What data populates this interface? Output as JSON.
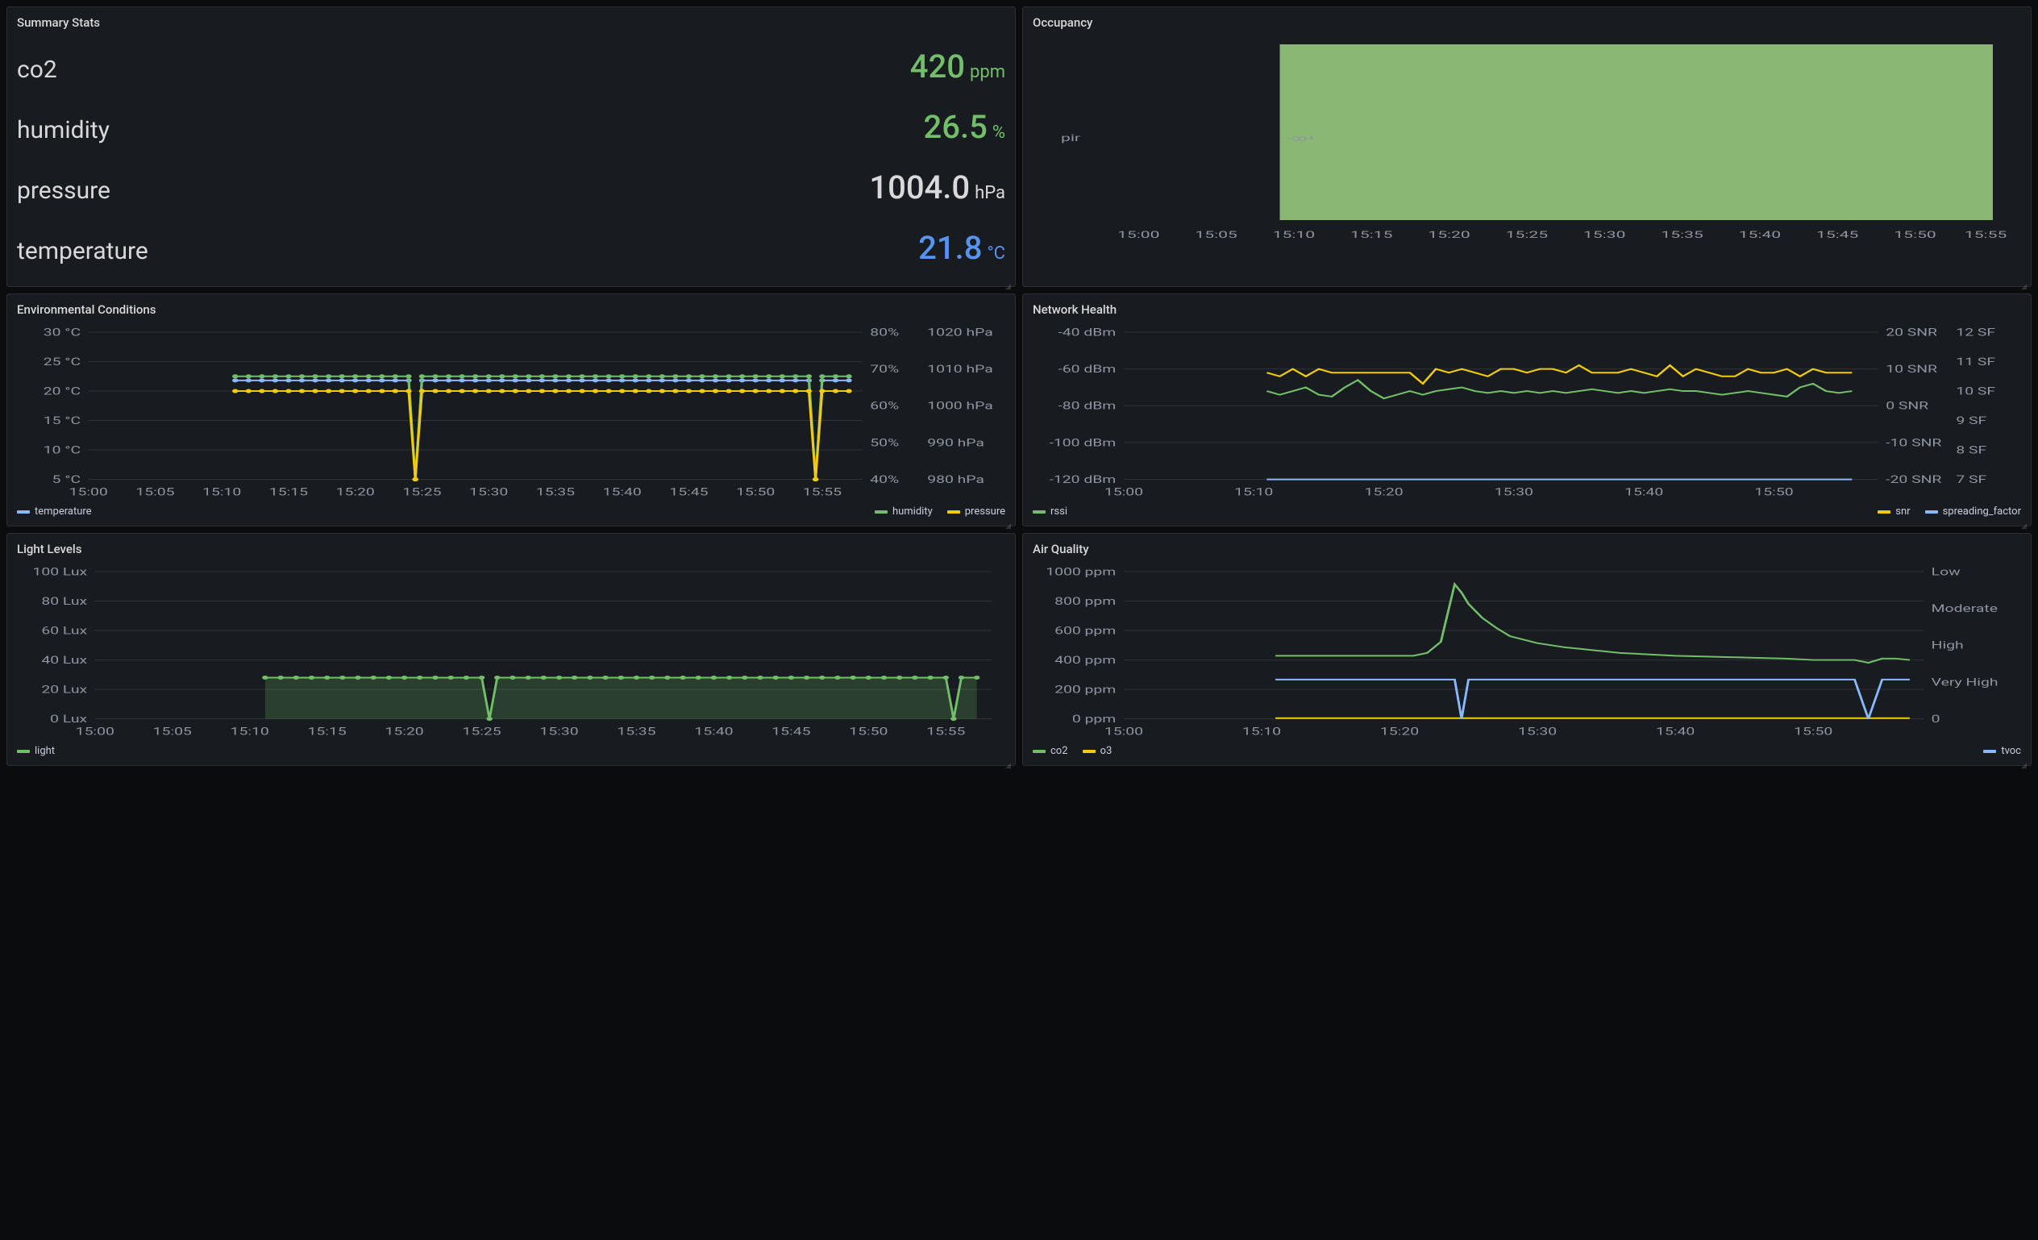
{
  "panels": {
    "summary": {
      "title": "Summary Stats",
      "stats": {
        "co2": {
          "label": "co2",
          "value": "420",
          "unit": "ppm",
          "color": "green"
        },
        "humidity": {
          "label": "humidity",
          "value": "26.5",
          "unit": "%",
          "color": "green"
        },
        "pressure": {
          "label": "pressure",
          "value": "1004.0",
          "unit": "hPa",
          "color": "white"
        },
        "temperature": {
          "label": "temperature",
          "value": "21.8",
          "unit": "°C",
          "color": "blue"
        }
      }
    },
    "occupancy": {
      "title": "Occupancy",
      "ylabel": "pir",
      "annotation": "-∞+"
    },
    "env": {
      "title": "Environmental Conditions"
    },
    "network": {
      "title": "Network Health"
    },
    "light": {
      "title": "Light Levels"
    },
    "air": {
      "title": "Air Quality"
    }
  },
  "legends": {
    "env": {
      "temperature": "temperature",
      "humidity": "humidity",
      "pressure": "pressure"
    },
    "network": {
      "rssi": "rssi",
      "snr": "snr",
      "sf": "spreading_factor"
    },
    "light": {
      "light": "light"
    },
    "air": {
      "co2": "co2",
      "o3": "o3",
      "tvoc": "tvoc"
    }
  },
  "colors": {
    "green": "#73bf69",
    "yellow": "#f2cc0c",
    "blue": "#8ab8ff",
    "lightblue": "#8ab8ff",
    "white": "#d8d9da"
  },
  "chart_data": [
    {
      "id": "occupancy",
      "type": "heatmap",
      "title": "Occupancy",
      "xlabel": "",
      "ylabel": "pir",
      "x_ticks": [
        "15:00",
        "15:05",
        "15:10",
        "15:15",
        "15:20",
        "15:25",
        "15:30",
        "15:35",
        "15:40",
        "15:45",
        "15:50",
        "15:55"
      ],
      "filled_from": "15:10",
      "filled_to": "15:57",
      "annotation": "-∞+"
    },
    {
      "id": "environmental_conditions",
      "type": "line",
      "title": "Environmental Conditions",
      "x": [
        "15:11",
        "15:12",
        "15:13",
        "15:14",
        "15:15",
        "15:16",
        "15:17",
        "15:18",
        "15:19",
        "15:20",
        "15:21",
        "15:22",
        "15:23",
        "15:24",
        "15:24:30",
        "15:25",
        "15:26",
        "15:27",
        "15:28",
        "15:29",
        "15:30",
        "15:31",
        "15:32",
        "15:33",
        "15:34",
        "15:35",
        "15:36",
        "15:37",
        "15:38",
        "15:39",
        "15:40",
        "15:41",
        "15:42",
        "15:43",
        "15:44",
        "15:45",
        "15:46",
        "15:47",
        "15:48",
        "15:49",
        "15:50",
        "15:51",
        "15:52",
        "15:53",
        "15:54",
        "15:54:30",
        "15:55",
        "15:56",
        "15:57"
      ],
      "series": [
        {
          "name": "temperature",
          "unit": "°C",
          "axis": "left",
          "color": "#8ab8ff",
          "values": [
            21.8,
            21.8,
            21.8,
            21.8,
            21.8,
            21.8,
            21.8,
            21.8,
            21.8,
            21.8,
            21.8,
            21.8,
            21.8,
            21.8,
            5,
            21.8,
            21.8,
            21.8,
            21.8,
            21.8,
            21.8,
            21.8,
            21.8,
            21.8,
            21.8,
            21.8,
            21.8,
            21.8,
            21.8,
            21.8,
            21.8,
            21.8,
            21.8,
            21.8,
            21.8,
            21.8,
            21.8,
            21.8,
            21.8,
            21.8,
            21.8,
            21.8,
            21.8,
            21.8,
            21.8,
            5,
            21.8,
            21.8,
            21.8
          ]
        },
        {
          "name": "humidity",
          "unit": "%",
          "axis": "right1",
          "color": "#73bf69",
          "values": [
            68,
            68,
            68,
            68,
            68,
            68,
            68,
            68,
            68,
            68,
            68,
            68,
            68,
            68,
            40,
            68,
            68,
            68,
            68,
            68,
            68,
            68,
            68,
            68,
            68,
            68,
            68,
            68,
            68,
            68,
            68,
            68,
            68,
            68,
            68,
            68,
            68,
            68,
            68,
            68,
            68,
            68,
            68,
            68,
            68,
            40,
            68,
            68,
            68
          ]
        },
        {
          "name": "pressure",
          "unit": "hPa",
          "axis": "right2",
          "color": "#f2cc0c",
          "values": [
            1004,
            1004,
            1004,
            1004,
            1004,
            1004,
            1004,
            1004,
            1004,
            1004,
            1004,
            1004,
            1004,
            1004,
            980,
            1004,
            1004,
            1004,
            1004,
            1004,
            1004,
            1004,
            1004,
            1004,
            1004,
            1004,
            1004,
            1004,
            1004,
            1004,
            1004,
            1004,
            1004,
            1004,
            1004,
            1004,
            1004,
            1004,
            1004,
            1004,
            1004,
            1004,
            1004,
            1004,
            1004,
            980,
            1004,
            1004,
            1004
          ]
        }
      ],
      "axes": {
        "left": {
          "label": "",
          "ticks": [
            "5 °C",
            "10 °C",
            "15 °C",
            "20 °C",
            "25 °C",
            "30 °C"
          ],
          "range": [
            5,
            30
          ]
        },
        "right1": {
          "label": "",
          "ticks": [
            "40%",
            "50%",
            "60%",
            "70%",
            "80%"
          ],
          "range": [
            40,
            80
          ]
        },
        "right2": {
          "label": "",
          "ticks": [
            "980 hPa",
            "990 hPa",
            "1000 hPa",
            "1010 hPa",
            "1020 hPa"
          ],
          "range": [
            980,
            1020
          ]
        }
      },
      "x_ticks": [
        "15:00",
        "15:05",
        "15:10",
        "15:15",
        "15:20",
        "15:25",
        "15:30",
        "15:35",
        "15:40",
        "15:45",
        "15:50",
        "15:55"
      ]
    },
    {
      "id": "network_health",
      "type": "line",
      "title": "Network Health",
      "x": [
        "15:11",
        "15:12",
        "15:13",
        "15:14",
        "15:15",
        "15:16",
        "15:17",
        "15:18",
        "15:19",
        "15:20",
        "15:21",
        "15:22",
        "15:23",
        "15:24",
        "15:25",
        "15:26",
        "15:27",
        "15:28",
        "15:29",
        "15:30",
        "15:31",
        "15:32",
        "15:33",
        "15:34",
        "15:35",
        "15:36",
        "15:37",
        "15:38",
        "15:39",
        "15:40",
        "15:41",
        "15:42",
        "15:43",
        "15:44",
        "15:45",
        "15:46",
        "15:47",
        "15:48",
        "15:49",
        "15:50",
        "15:51",
        "15:52",
        "15:53",
        "15:54",
        "15:55",
        "15:56"
      ],
      "series": [
        {
          "name": "rssi",
          "unit": "dBm",
          "axis": "left",
          "color": "#73bf69",
          "values": [
            -72,
            -74,
            -72,
            -70,
            -74,
            -75,
            -70,
            -66,
            -72,
            -76,
            -74,
            -72,
            -74,
            -72,
            -71,
            -70,
            -72,
            -73,
            -72,
            -73,
            -72,
            -73,
            -72,
            -73,
            -72,
            -71,
            -72,
            -73,
            -72,
            -73,
            -72,
            -71,
            -72,
            -72,
            -73,
            -74,
            -73,
            -72,
            -73,
            -74,
            -75,
            -70,
            -68,
            -72,
            -73,
            -72
          ]
        },
        {
          "name": "snr",
          "unit": "SNR",
          "axis": "right1",
          "color": "#f2cc0c",
          "values": [
            9,
            8,
            10,
            8,
            10,
            9,
            9,
            9,
            9,
            9,
            9,
            9,
            6,
            10,
            9,
            10,
            9,
            8,
            10,
            10,
            9,
            10,
            10,
            9,
            11,
            9,
            9,
            9,
            10,
            9,
            8,
            11,
            8,
            10,
            9,
            8,
            8,
            10,
            9,
            9,
            10,
            8,
            10,
            9,
            9,
            9
          ]
        },
        {
          "name": "spreading_factor",
          "unit": "SF",
          "axis": "right2",
          "color": "#8ab8ff",
          "values": [
            7,
            7,
            7,
            7,
            7,
            7,
            7,
            7,
            7,
            7,
            7,
            7,
            7,
            7,
            7,
            7,
            7,
            7,
            7,
            7,
            7,
            7,
            7,
            7,
            7,
            7,
            7,
            7,
            7,
            7,
            7,
            7,
            7,
            7,
            7,
            7,
            7,
            7,
            7,
            7,
            7,
            7,
            7,
            7,
            7,
            7
          ]
        }
      ],
      "axes": {
        "left": {
          "ticks": [
            "-120 dBm",
            "-100 dBm",
            "-80 dBm",
            "-60 dBm",
            "-40 dBm"
          ],
          "range": [
            -120,
            -40
          ]
        },
        "right1": {
          "ticks": [
            "-20 SNR",
            "-10 SNR",
            "0 SNR",
            "10 SNR",
            "20 SNR"
          ],
          "range": [
            -20,
            20
          ]
        },
        "right2": {
          "ticks": [
            "7 SF",
            "8 SF",
            "9 SF",
            "10 SF",
            "11 SF",
            "12 SF"
          ],
          "range": [
            7,
            12
          ]
        }
      },
      "x_ticks": [
        "15:00",
        "15:10",
        "15:20",
        "15:30",
        "15:40",
        "15:50"
      ]
    },
    {
      "id": "light_levels",
      "type": "area",
      "title": "Light Levels",
      "x": [
        "15:11",
        "15:12",
        "15:13",
        "15:14",
        "15:15",
        "15:16",
        "15:17",
        "15:18",
        "15:19",
        "15:20",
        "15:21",
        "15:22",
        "15:23",
        "15:24",
        "15:25",
        "15:25:30",
        "15:26",
        "15:27",
        "15:28",
        "15:29",
        "15:30",
        "15:31",
        "15:32",
        "15:33",
        "15:34",
        "15:35",
        "15:36",
        "15:37",
        "15:38",
        "15:39",
        "15:40",
        "15:41",
        "15:42",
        "15:43",
        "15:44",
        "15:45",
        "15:46",
        "15:47",
        "15:48",
        "15:49",
        "15:50",
        "15:51",
        "15:52",
        "15:53",
        "15:54",
        "15:55",
        "15:55:30",
        "15:56",
        "15:57"
      ],
      "series": [
        {
          "name": "light",
          "unit": "Lux",
          "color": "#73bf69",
          "values": [
            28,
            28,
            28,
            28,
            28,
            28,
            28,
            28,
            28,
            28,
            28,
            28,
            28,
            28,
            28,
            0,
            28,
            28,
            28,
            28,
            28,
            28,
            28,
            28,
            28,
            28,
            28,
            28,
            28,
            28,
            28,
            28,
            28,
            28,
            28,
            28,
            28,
            28,
            28,
            28,
            28,
            28,
            28,
            28,
            28,
            28,
            0,
            28,
            28
          ]
        }
      ],
      "axes": {
        "left": {
          "ticks": [
            "0 Lux",
            "20 Lux",
            "40 Lux",
            "60 Lux",
            "80 Lux",
            "100 Lux"
          ],
          "range": [
            0,
            100
          ]
        }
      },
      "x_ticks": [
        "15:00",
        "15:05",
        "15:10",
        "15:15",
        "15:20",
        "15:25",
        "15:30",
        "15:35",
        "15:40",
        "15:45",
        "15:50",
        "15:55"
      ]
    },
    {
      "id": "air_quality",
      "type": "line",
      "title": "Air Quality",
      "x": [
        "15:11",
        "15:13",
        "15:15",
        "15:17",
        "15:19",
        "15:21",
        "15:22",
        "15:23",
        "15:24",
        "15:24:30",
        "15:25",
        "15:26",
        "15:27",
        "15:28",
        "15:30",
        "15:32",
        "15:34",
        "15:36",
        "15:38",
        "15:40",
        "15:42",
        "15:44",
        "15:46",
        "15:48",
        "15:50",
        "15:52",
        "15:53",
        "15:54",
        "15:55",
        "15:56",
        "15:57"
      ],
      "series": [
        {
          "name": "co2",
          "unit": "ppm",
          "axis": "left",
          "color": "#73bf69",
          "values": [
            450,
            450,
            450,
            450,
            450,
            450,
            470,
            550,
            960,
            900,
            820,
            720,
            650,
            590,
            540,
            510,
            490,
            470,
            460,
            450,
            445,
            440,
            435,
            430,
            420,
            420,
            420,
            400,
            430,
            430,
            420
          ]
        },
        {
          "name": "o3",
          "unit": "ppm",
          "axis": "left",
          "color": "#f2cc0c",
          "values": [
            5,
            5,
            5,
            5,
            5,
            5,
            5,
            5,
            5,
            5,
            5,
            5,
            5,
            5,
            5,
            5,
            5,
            5,
            5,
            5,
            5,
            5,
            5,
            5,
            5,
            5,
            5,
            5,
            5,
            5,
            5
          ]
        },
        {
          "name": "tvoc",
          "unit": "",
          "axis": "right",
          "color": "#8ab8ff",
          "values": [
            280,
            280,
            280,
            280,
            280,
            280,
            280,
            280,
            280,
            0,
            280,
            280,
            280,
            280,
            280,
            280,
            280,
            280,
            280,
            280,
            280,
            280,
            280,
            280,
            280,
            280,
            280,
            0,
            280,
            280,
            280
          ]
        }
      ],
      "axes": {
        "left": {
          "ticks": [
            "0 ppm",
            "200 ppm",
            "400 ppm",
            "600 ppm",
            "800 ppm",
            "1000 ppm"
          ],
          "range": [
            0,
            1050
          ]
        },
        "right": {
          "ticks": [
            "0",
            "Very High",
            "High",
            "Moderate",
            "Low"
          ],
          "categorical": true
        }
      },
      "x_ticks": [
        "15:00",
        "15:10",
        "15:20",
        "15:30",
        "15:40",
        "15:50"
      ]
    }
  ]
}
